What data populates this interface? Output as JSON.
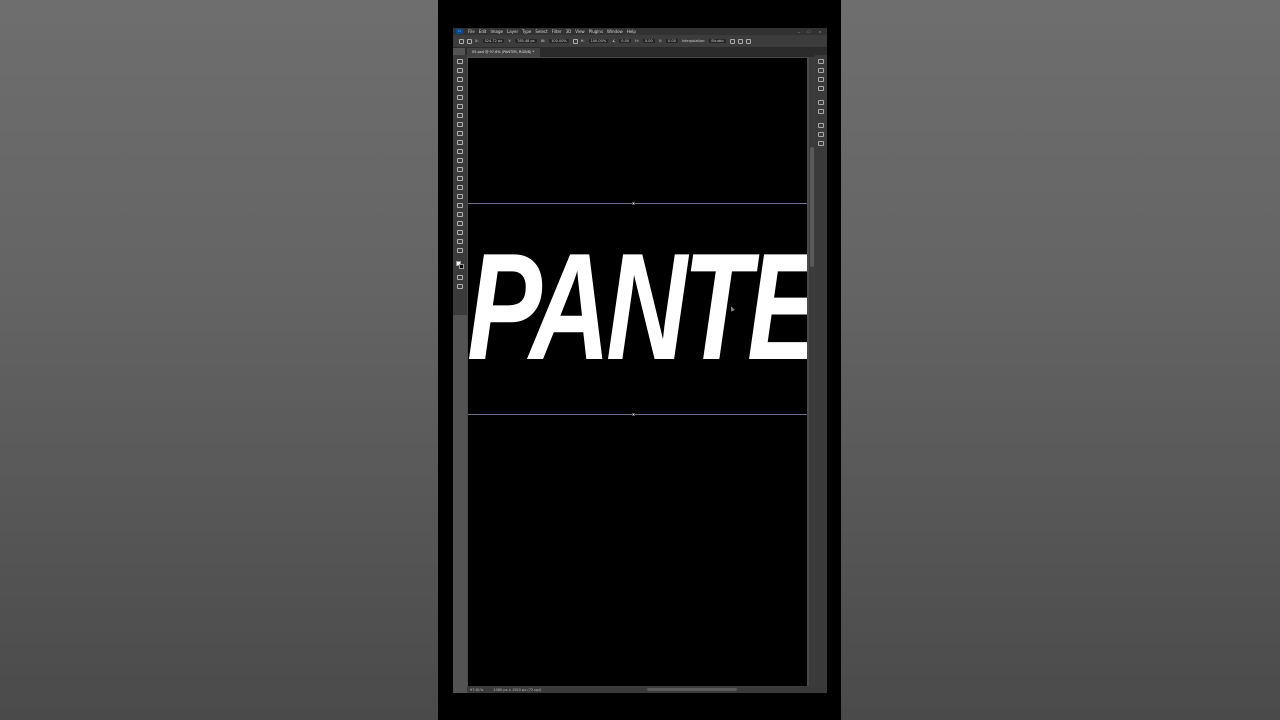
{
  "menubar": {
    "logo": "Ps",
    "items": [
      "File",
      "Edit",
      "Image",
      "Layer",
      "Type",
      "Select",
      "Filter",
      "3D",
      "View",
      "Plugins",
      "Window",
      "Help"
    ]
  },
  "options": {
    "x_value": "524.72 px",
    "y_value": "785.48 px",
    "w_value": "100.00%",
    "h_value": "100.00%",
    "angle_value": "0.00",
    "hskew_value": "0.00",
    "vskew_value": "0.00",
    "interpolation_label": "Interpolation:",
    "interpolation_value": "Bicubic"
  },
  "document": {
    "tab_label": "05.psd @ 97.6% (PANTER, RGB/8) *"
  },
  "canvas": {
    "text": "PANTER",
    "background": "#000000",
    "text_color": "#ffffff"
  },
  "status": {
    "zoom": "97.61%",
    "doc_info": "1080 px x 1920 px (72 ppi)"
  }
}
